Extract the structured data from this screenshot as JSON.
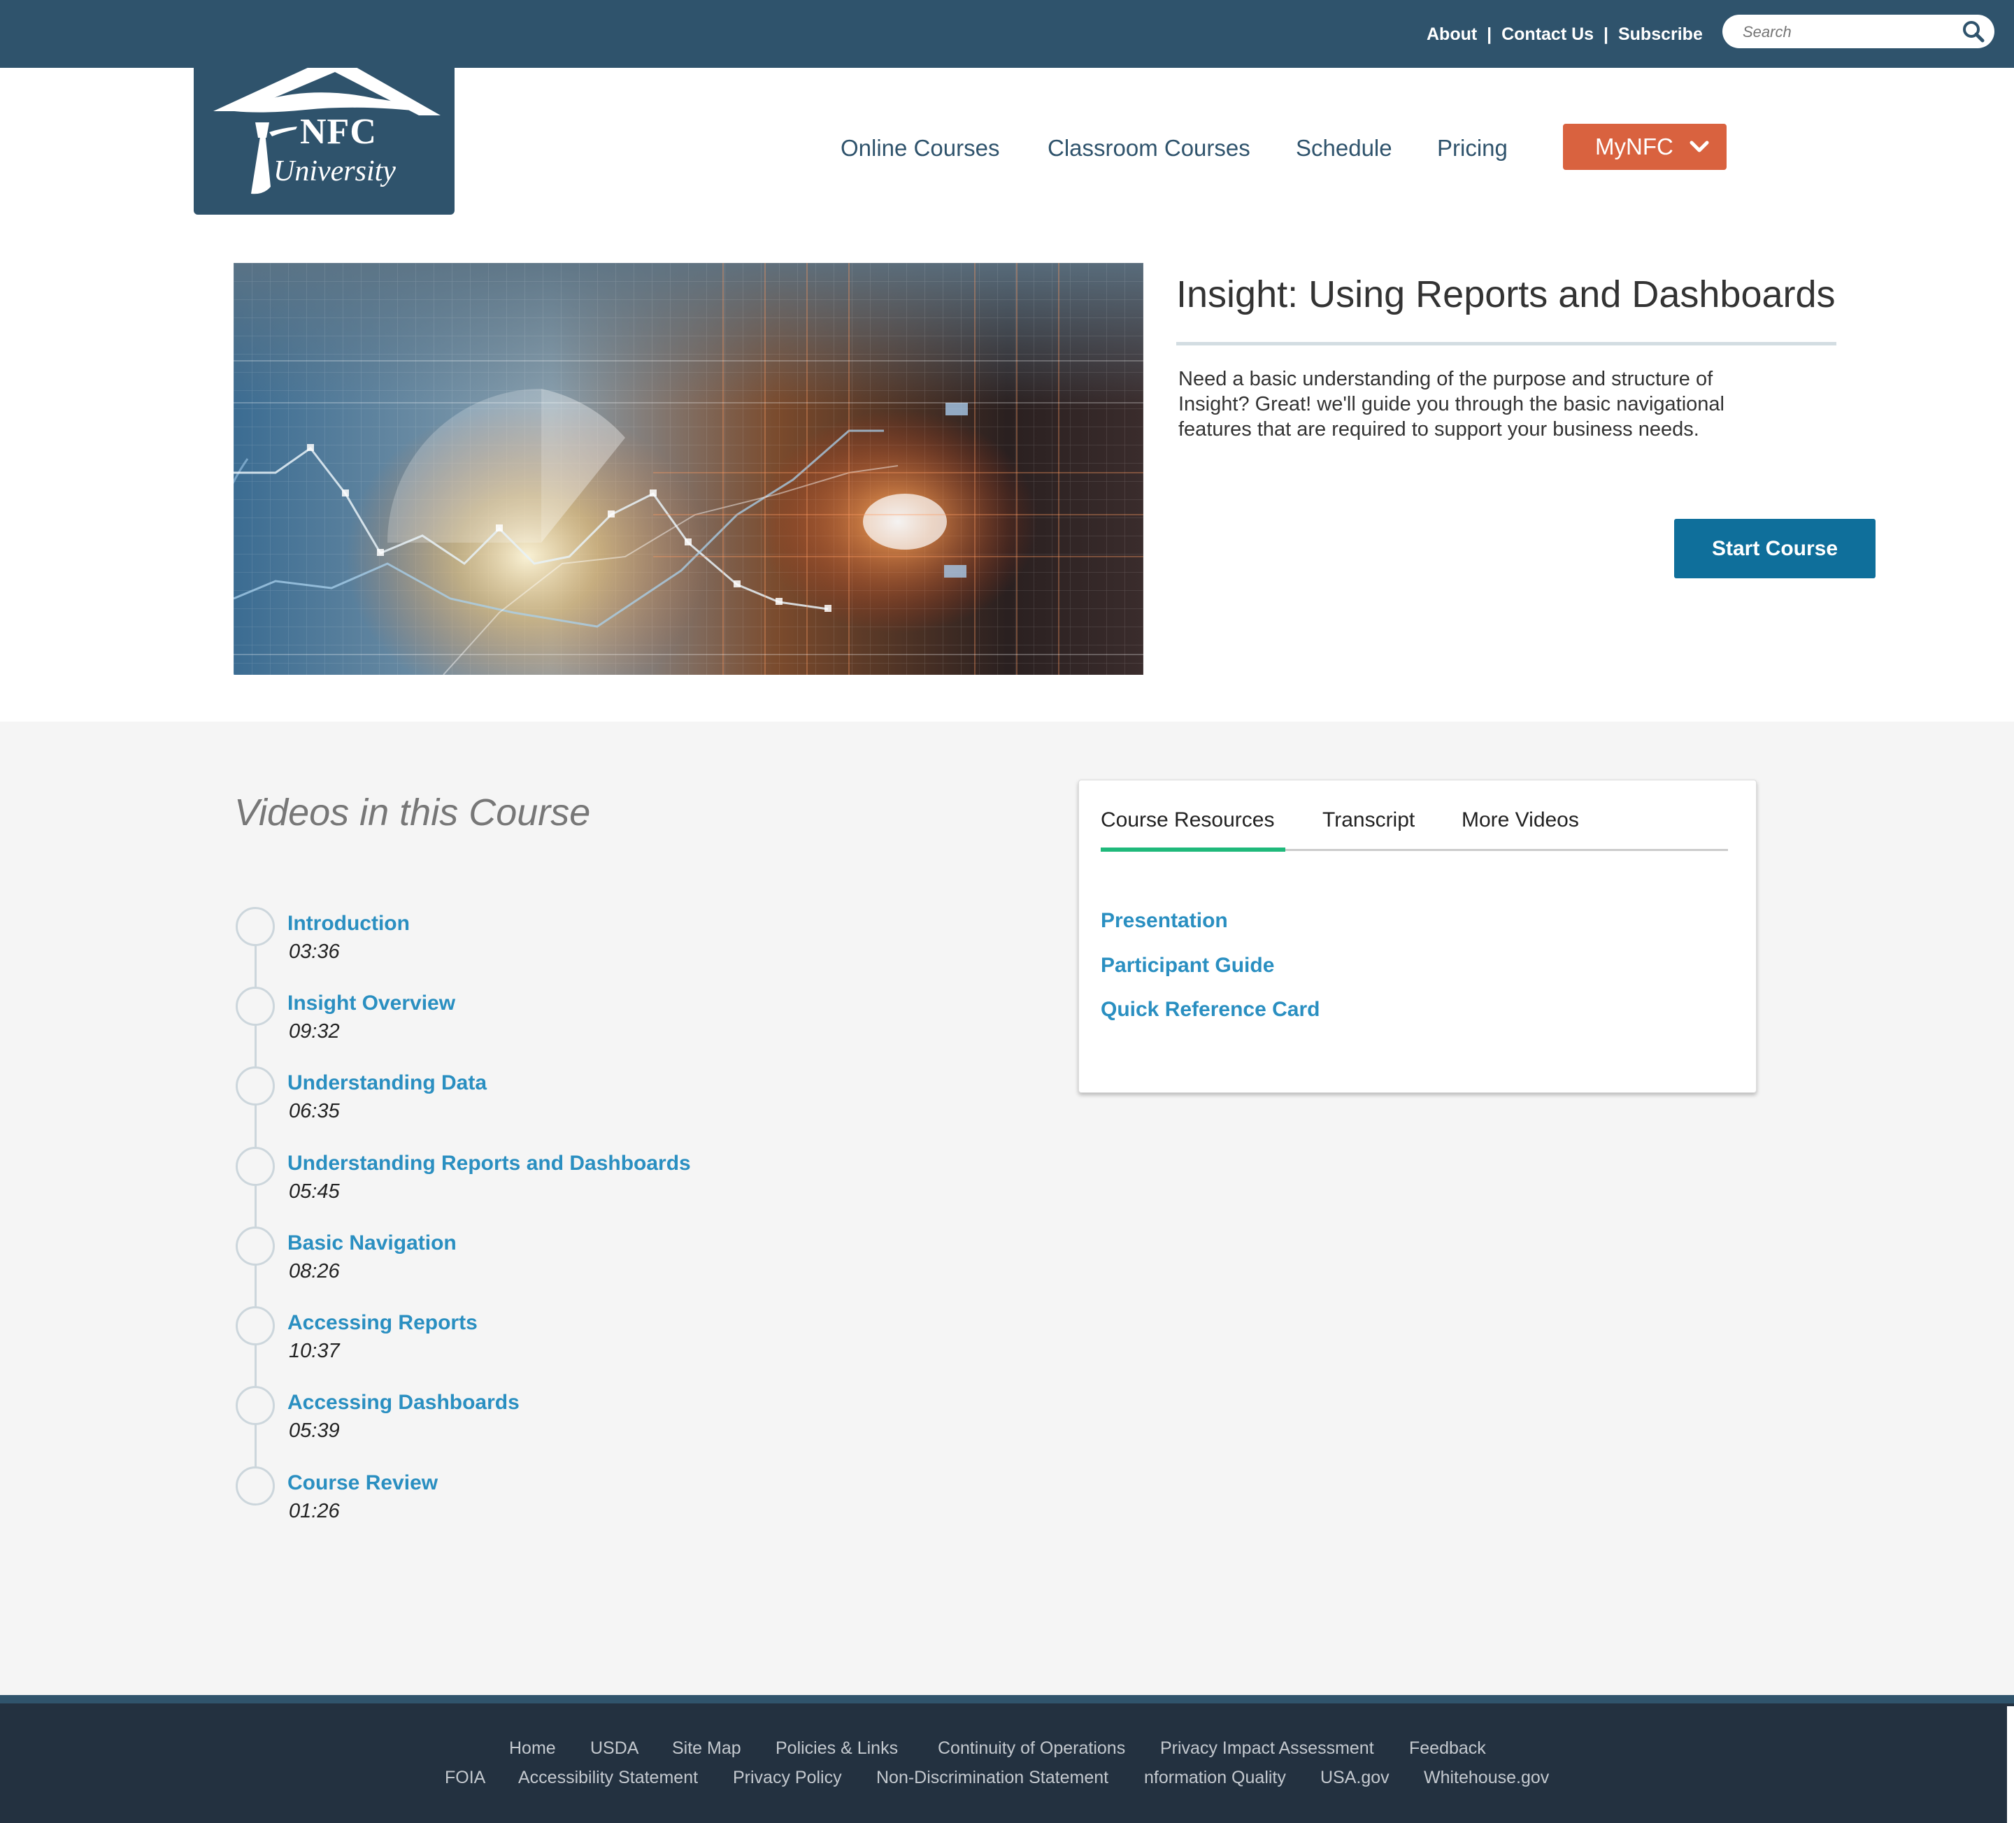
{
  "topbar": {
    "links": [
      "About",
      "Contact Us",
      "Subscribe"
    ],
    "separator": "|",
    "search_placeholder": "Search"
  },
  "logo": {
    "line1": "NFC",
    "line2": "University"
  },
  "nav": {
    "items": [
      "Online Courses",
      "Classroom Courses",
      "Schedule",
      "Pricing"
    ],
    "mynfc_label": "MyNFC"
  },
  "course": {
    "title": "Insight: Using Reports and Dashboards",
    "description": "Need a basic understanding of the purpose and structure of Insight? Great! we'll guide you through the basic navigational features that are required to support your business needs.",
    "start_label": "Start Course"
  },
  "videos": {
    "heading": "Videos in this Course",
    "items": [
      {
        "title": "Introduction",
        "duration": "03:36"
      },
      {
        "title": "Insight Overview",
        "duration": "09:32"
      },
      {
        "title": "Understanding Data",
        "duration": "06:35"
      },
      {
        "title": "Understanding Reports and Dashboards",
        "duration": "05:45"
      },
      {
        "title": "Basic Navigation",
        "duration": "08:26"
      },
      {
        "title": "Accessing Reports",
        "duration": "10:37"
      },
      {
        "title": "Accessing Dashboards",
        "duration": "05:39"
      },
      {
        "title": "Course Review",
        "duration": "01:26"
      }
    ]
  },
  "resources": {
    "tabs": [
      "Course Resources",
      "Transcript",
      "More Videos"
    ],
    "active_tab": "Course Resources",
    "links": [
      "Presentation",
      "Participant Guide",
      "Quick Reference Card"
    ]
  },
  "footer": {
    "row1": [
      "Home",
      "USDA",
      "Site Map",
      "Policies & Links",
      "Continuity of Operations",
      "Privacy Impact Assessment",
      "Feedback"
    ],
    "row2": [
      "FOIA",
      "Accessibility Statement",
      "Privacy Policy",
      "Non-Discrimination Statement",
      "nformation Quality",
      "USA.gov",
      "Whitehouse.gov"
    ]
  },
  "colors": {
    "brand_dark": "#2f536c",
    "accent_orange": "#d9623f",
    "button_blue": "#0f6f9b",
    "link_blue": "#2a8fc1",
    "tab_green": "#1fb97b",
    "footer_bg": "#233140"
  },
  "icons": {
    "search": "search-icon",
    "mynfc_chevron": "chevron-down-icon",
    "logo": "graduation-cap-icon"
  }
}
